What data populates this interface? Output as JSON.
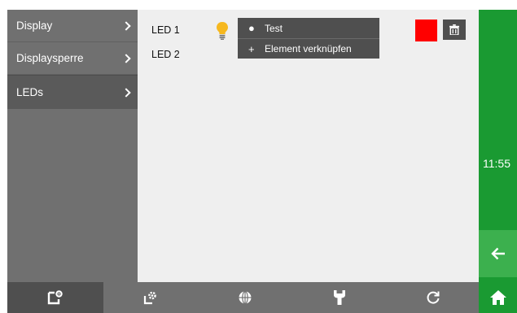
{
  "sidebar": {
    "items": [
      {
        "label": "Display"
      },
      {
        "label": "Displaysperre"
      },
      {
        "label": "LEDs"
      }
    ]
  },
  "leds": [
    {
      "label": "LED 1"
    },
    {
      "label": "LED 2"
    }
  ],
  "dropdown": {
    "items": [
      {
        "label": "Test",
        "icon": "bullet-icon"
      },
      {
        "label": "Element verknüpfen",
        "icon": "plus-icon"
      }
    ]
  },
  "led1_color": "#ff0000",
  "clock": "11:55",
  "toolbar": {
    "buttons": [
      "widget-settings-icon",
      "system-settings-icon",
      "globe-icon",
      "wrench-icon",
      "refresh-icon"
    ]
  },
  "colors": {
    "sidebar": "#707070",
    "sidebar_active": "#5a5a5a",
    "content_bg": "#efefef",
    "accent_green": "#1a9a32",
    "back_green": "#3cb04e",
    "bulb": "#f6b81f"
  }
}
